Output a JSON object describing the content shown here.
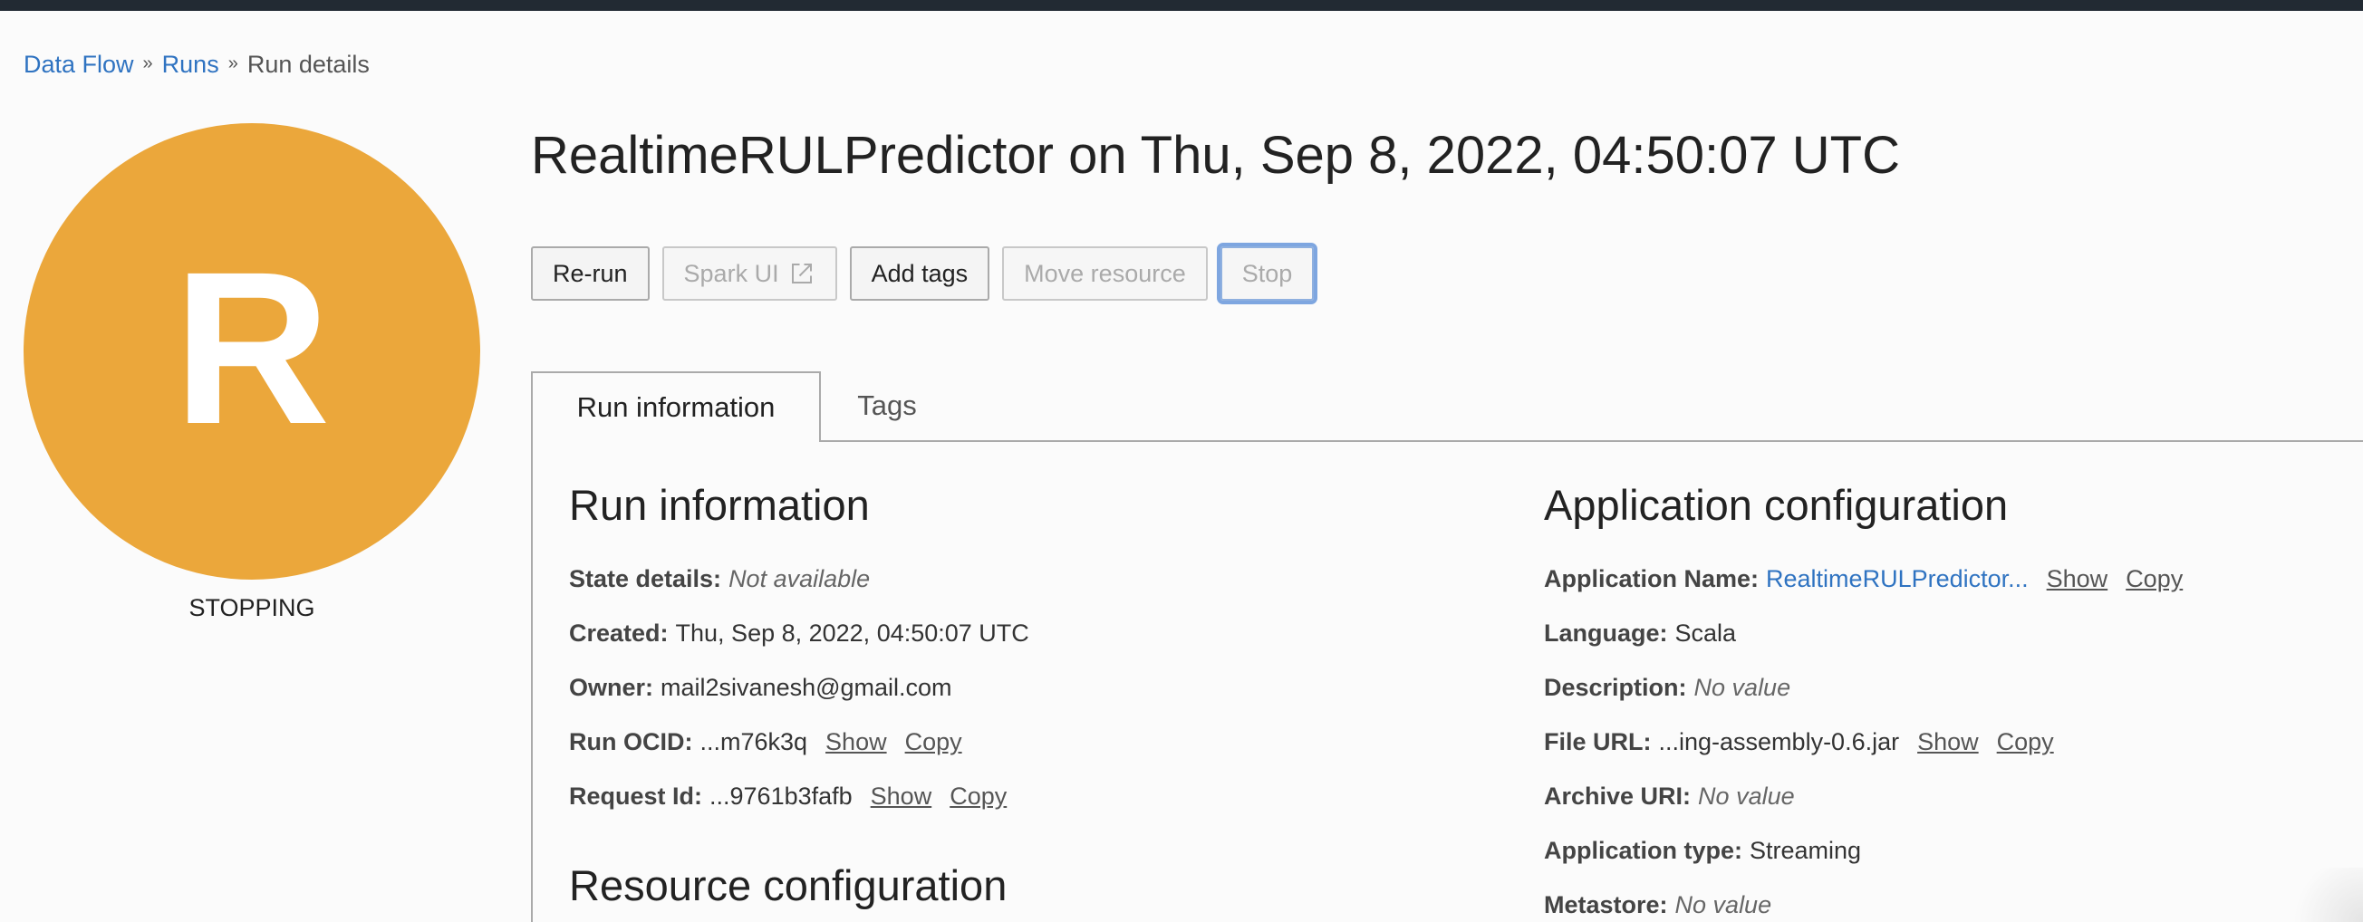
{
  "breadcrumb": {
    "items": [
      "Data Flow",
      "Runs"
    ],
    "separator": "»",
    "current": "Run details"
  },
  "avatar": {
    "letter": "R",
    "color": "#eba73b"
  },
  "state": "STOPPING",
  "title": "RealtimeRULPredictor on Thu, Sep 8, 2022, 04:50:07 UTC",
  "actions": {
    "rerun": "Re-run",
    "spark_ui": "Spark UI",
    "add_tags": "Add tags",
    "move_resource": "Move resource",
    "stop": "Stop"
  },
  "tabs": {
    "run_info": "Run information",
    "tags": "Tags"
  },
  "run_info": {
    "heading": "Run information",
    "state_details": {
      "label": "State details:",
      "value": "Not available"
    },
    "created": {
      "label": "Created:",
      "value": "Thu, Sep 8, 2022, 04:50:07 UTC"
    },
    "owner": {
      "label": "Owner:",
      "value": "mail2sivanesh@gmail.com"
    },
    "run_ocid": {
      "label": "Run OCID:",
      "value": "...m76k3q",
      "show": "Show",
      "copy": "Copy"
    },
    "request_id": {
      "label": "Request Id:",
      "value": "...9761b3fafb",
      "show": "Show",
      "copy": "Copy"
    }
  },
  "resource_config": {
    "heading": "Resource configuration"
  },
  "app_config": {
    "heading": "Application configuration",
    "app_name": {
      "label": "Application Name:",
      "value": "RealtimeRULPredictor...",
      "show": "Show",
      "copy": "Copy"
    },
    "language": {
      "label": "Language:",
      "value": "Scala"
    },
    "description": {
      "label": "Description:",
      "value": "No value"
    },
    "file_url": {
      "label": "File URL:",
      "value": "...ing-assembly-0.6.jar",
      "show": "Show",
      "copy": "Copy"
    },
    "archive_uri": {
      "label": "Archive URI:",
      "value": "No value"
    },
    "app_type": {
      "label": "Application type:",
      "value": "Streaming"
    },
    "metastore": {
      "label": "Metastore:",
      "value": "No value"
    }
  },
  "colors": {
    "link": "#2f73c1",
    "topbar": "#222a33",
    "focus": "#7ea6e0"
  }
}
